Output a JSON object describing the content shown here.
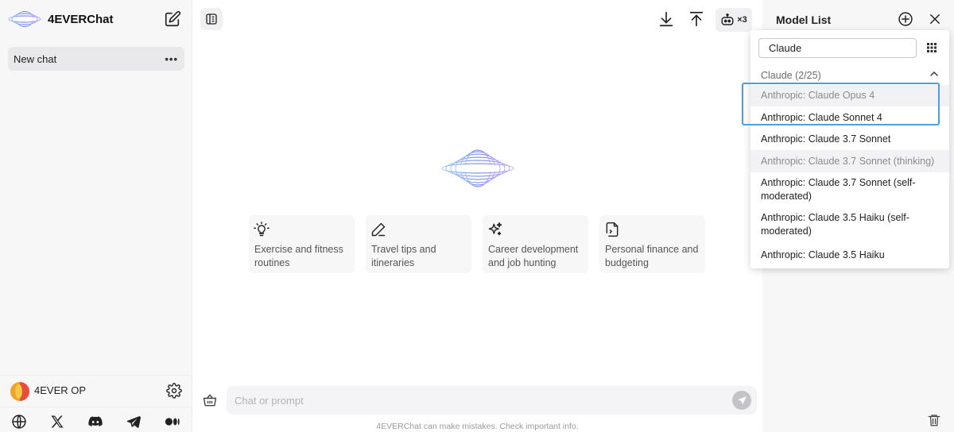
{
  "sidebar": {
    "brand": "4EVERChat",
    "chats": [
      {
        "label": "New chat",
        "more": "•••"
      }
    ],
    "account": {
      "name": "4EVER OP"
    }
  },
  "main": {
    "robot_count": "×3",
    "prompt_cards": [
      {
        "text": "Exercise and fitness routines",
        "icon": "lightbulb-icon"
      },
      {
        "text": "Travel tips and itineraries",
        "icon": "pen-icon"
      },
      {
        "text": "Career development and job hunting",
        "icon": "sparkles-icon"
      },
      {
        "text": "Personal finance and budgeting",
        "icon": "finance-file-icon"
      }
    ],
    "input_placeholder": "Chat or prompt",
    "disclaimer": "4EVERChat can make mistakes. Check important info."
  },
  "panel": {
    "title": "Model List",
    "dropdown": {
      "search_value": "Claude",
      "group_label": "Claude (2/25)",
      "items": [
        {
          "label": "Anthropic: Claude Opus 4",
          "state": "selected"
        },
        {
          "label": "Anthropic: Claude Sonnet 4",
          "state": "normal"
        },
        {
          "label": "Anthropic: Claude 3.7 Sonnet",
          "state": "normal"
        },
        {
          "label": "Anthropic: Claude 3.7 Sonnet (thinking)",
          "state": "selected"
        },
        {
          "label": "Anthropic: Claude 3.7 Sonnet (self-moderated)",
          "state": "normal"
        },
        {
          "label": "Anthropic: Claude 3.5 Haiku (self-moderated)",
          "state": "normal"
        },
        {
          "label": "Anthropic: Claude 3.5 Haiku",
          "state": "normal"
        }
      ]
    }
  },
  "colors": {
    "accent": "#4a9fe0",
    "logo": "#6a8ff0",
    "sidebar_bg": "#f7f7f8"
  }
}
